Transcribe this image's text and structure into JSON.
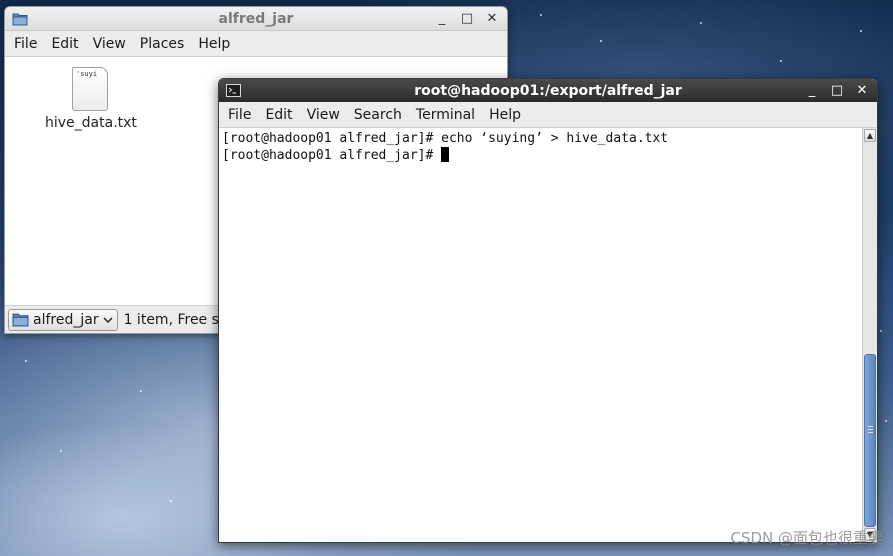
{
  "file_manager": {
    "title": "alfred_jar",
    "menu": [
      "File",
      "Edit",
      "View",
      "Places",
      "Help"
    ],
    "files": [
      {
        "name": "hive_data.txt",
        "preview": "'suyi",
        "icon": "text-file-icon"
      }
    ],
    "path_combo": "alfred_jar",
    "status": "1 item, Free spa"
  },
  "terminal": {
    "title": "root@hadoop01:/export/alfred_jar",
    "menu": [
      "File",
      "Edit",
      "View",
      "Search",
      "Terminal",
      "Help"
    ],
    "lines": [
      "[root@hadoop01 alfred_jar]# echo ‘suying’ > hive_data.txt",
      "[root@hadoop01 alfred_jar]# "
    ],
    "scrollbar_position": 0.55
  },
  "window_controls": {
    "minimize": "_",
    "maximize": "□",
    "close": "✕"
  },
  "watermark": "CSDN @面包也很重要",
  "colors": {
    "terminal_titlebar": "#2c2c2c",
    "scroll_thumb": "#5b86c0",
    "desktop_sky": "#1f3f6c"
  }
}
